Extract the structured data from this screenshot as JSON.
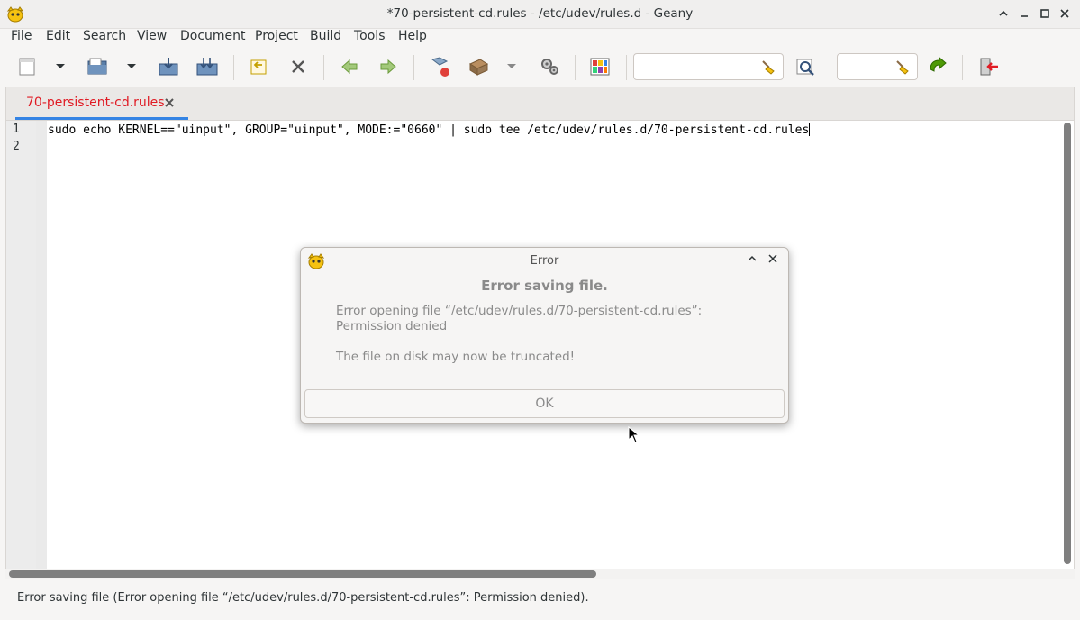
{
  "window": {
    "title": "*70-persistent-cd.rules - /etc/udev/rules.d - Geany"
  },
  "menu": [
    "File",
    "Edit",
    "Search",
    "View",
    "Document",
    "Project",
    "Build",
    "Tools",
    "Help"
  ],
  "toolbar": {
    "search_value": "",
    "goto_value": ""
  },
  "tabs": [
    {
      "label": "70-persistent-cd.rules"
    }
  ],
  "editor": {
    "line_numbers": [
      "1",
      "2"
    ],
    "lines": [
      "sudo echo KERNEL==\"uinput\", GROUP=\"uinput\", MODE:=\"0660\" | sudo tee /etc/udev/rules.d/70-persistent-cd.rules",
      ""
    ]
  },
  "dialog": {
    "title": "Error",
    "heading": "Error saving file.",
    "message": "Error opening file “/etc/udev/rules.d/70-persistent-cd.rules”: Permission denied",
    "secondary": "The file on disk may now be truncated!",
    "ok_label": "OK"
  },
  "statusbar": {
    "text": "Error saving file (Error opening file “/etc/udev/rules.d/70-persistent-cd.rules”: Permission denied)."
  },
  "colors": {
    "tab_label": "#e01b24",
    "tab_underline": "#3584e4",
    "long_line_marker": "#bfe3bf"
  }
}
